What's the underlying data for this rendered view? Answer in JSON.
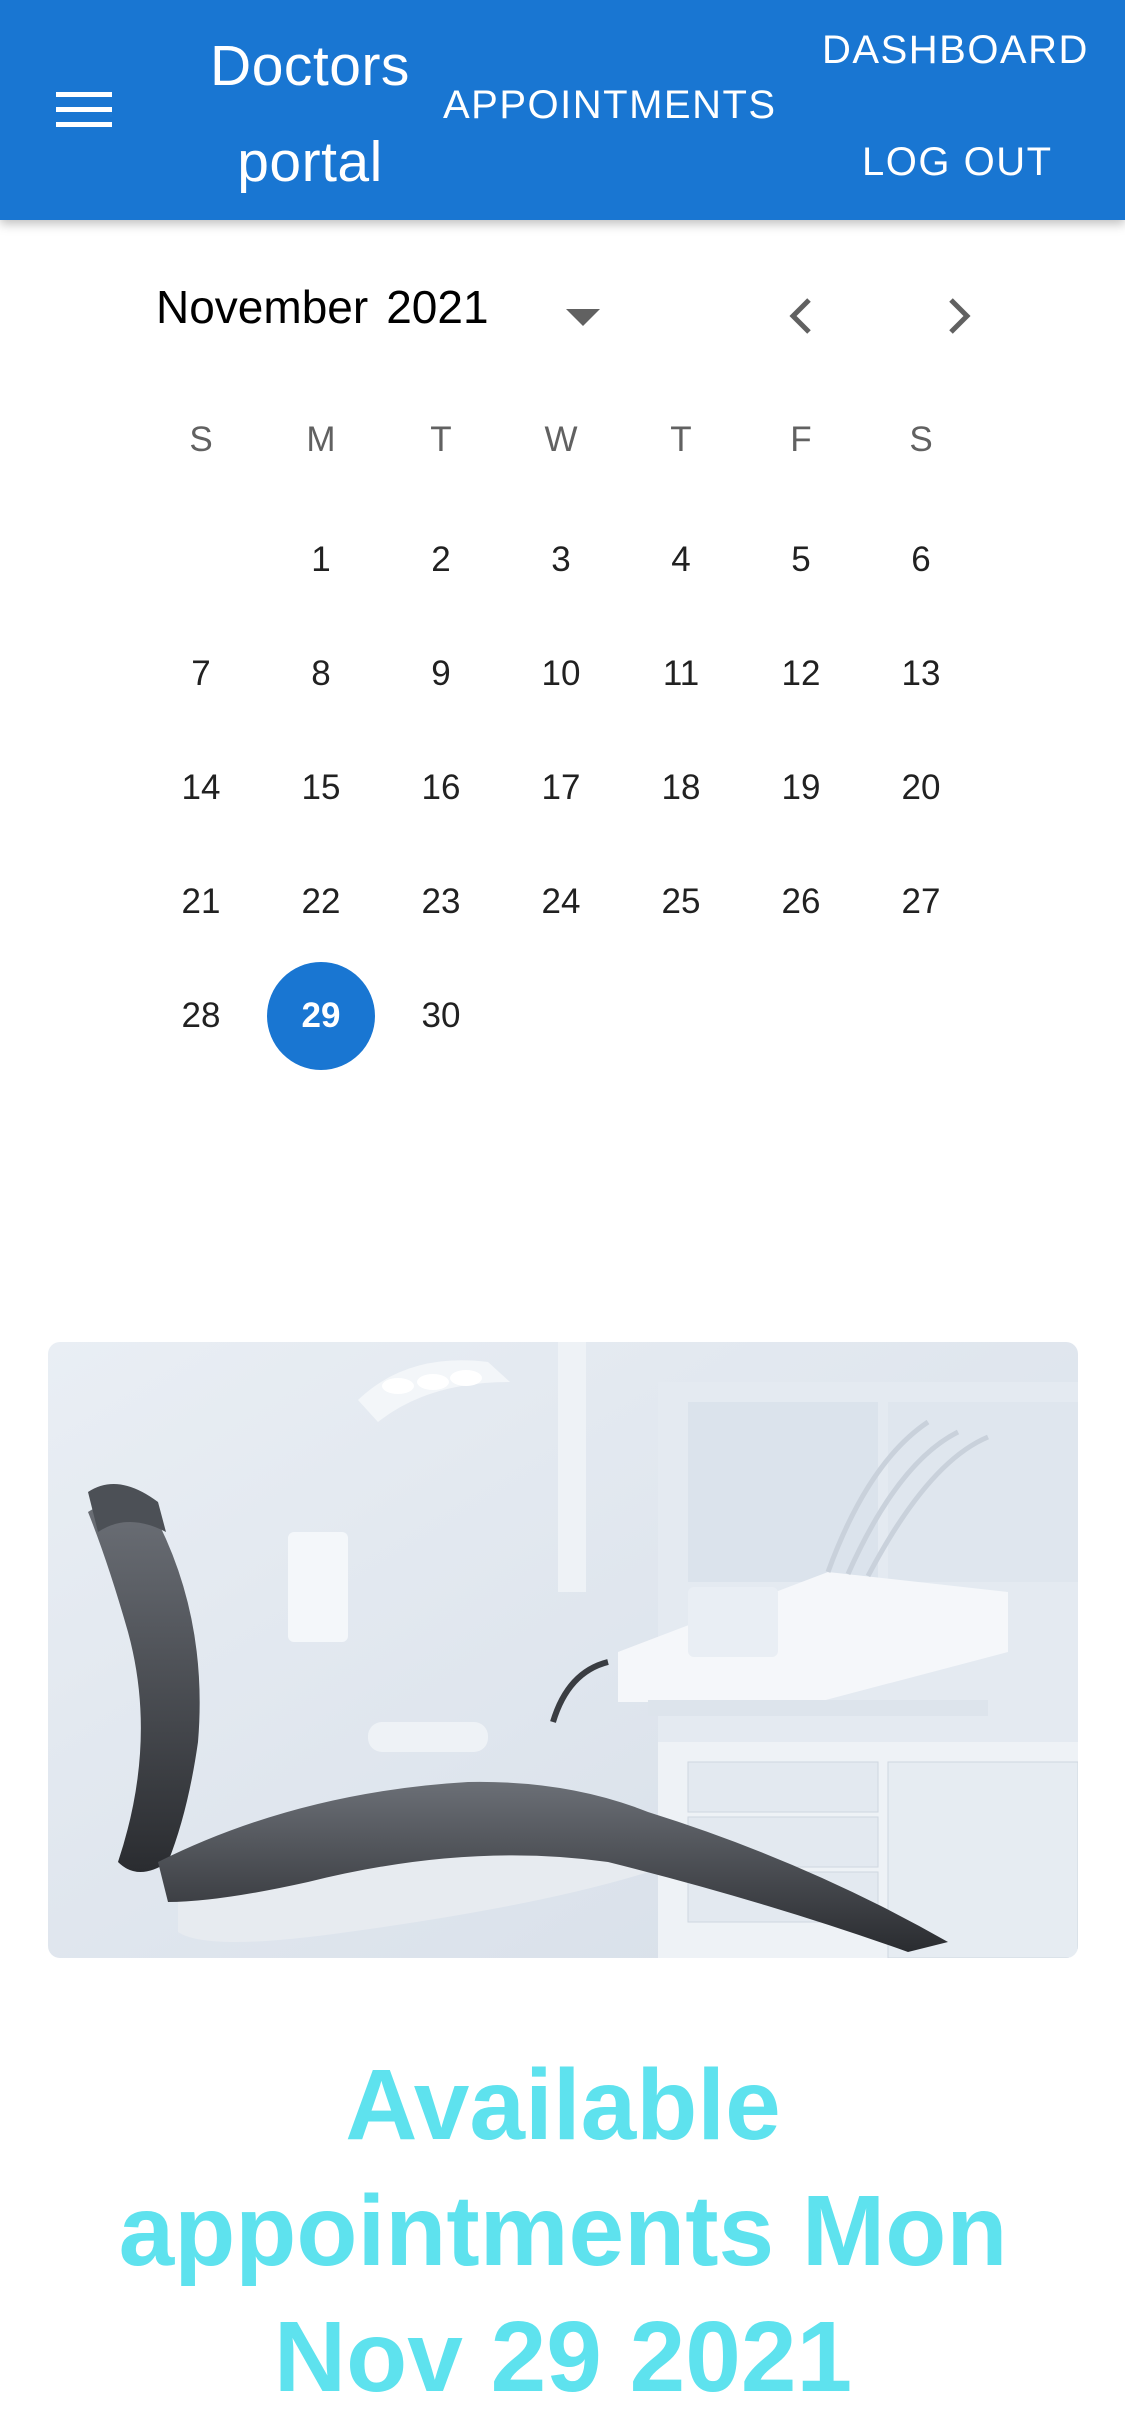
{
  "appbar": {
    "brand_line1": "Doctors",
    "brand_line2": "portal",
    "nav": {
      "appointments": "APPOINTMENTS",
      "dashboard": "DASHBOARD",
      "logout": "LOG OUT"
    },
    "menu_icon": "hamburger-menu-icon",
    "color": "#1976d2"
  },
  "calendar": {
    "month": "November",
    "year": "2021",
    "dropdown_icon": "caret-down-icon",
    "prev_icon": "chevron-left-icon",
    "next_icon": "chevron-right-icon",
    "weekdays": [
      "S",
      "M",
      "T",
      "W",
      "T",
      "F",
      "S"
    ],
    "first_weekday_index": 1,
    "days_in_month": 30,
    "selected_day": "29",
    "selected_color": "#1976d2"
  },
  "photo": {
    "subject": "dental-chair-image"
  },
  "heading": {
    "line1": "Available",
    "line2": "appointments Mon",
    "line3": "Nov 29 2021",
    "color": "#5ee2ee"
  }
}
